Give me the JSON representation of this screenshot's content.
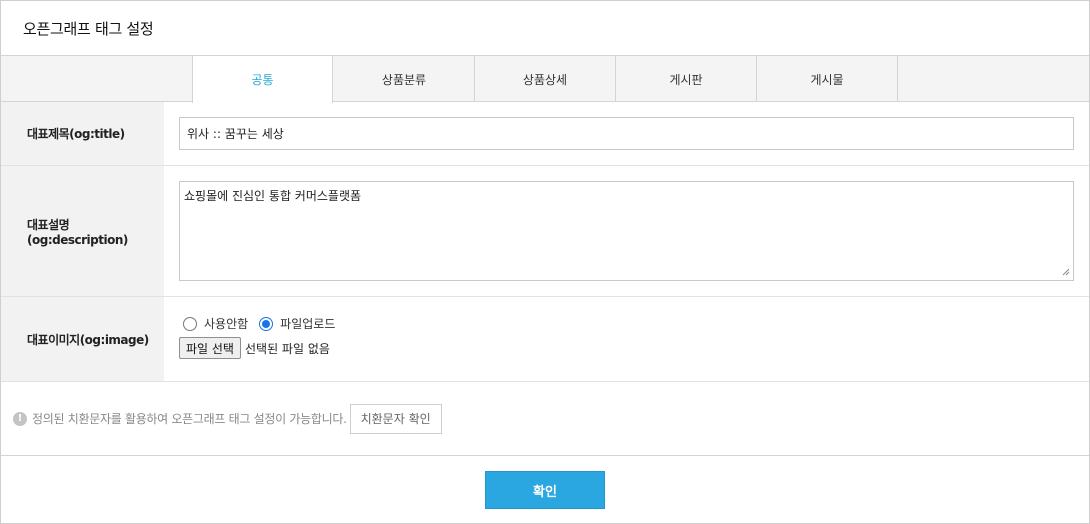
{
  "page": {
    "title": "오픈그래프 태그 설정"
  },
  "tabs": [
    {
      "label": "공통",
      "active": true
    },
    {
      "label": "상품분류",
      "active": false
    },
    {
      "label": "상품상세",
      "active": false
    },
    {
      "label": "게시판",
      "active": false
    },
    {
      "label": "게시물",
      "active": false
    }
  ],
  "form": {
    "og_title": {
      "label": "대표제목(og:title)",
      "value": "위사 :: 꿈꾸는 세상"
    },
    "og_description": {
      "label": "대표설명(og:description)",
      "value": "쇼핑몰에 진심인 통합 커머스플랫폼"
    },
    "og_image": {
      "label": "대표이미지(og:image)",
      "radio_none_label": "사용안함",
      "radio_upload_label": "파일업로드",
      "selected": "upload",
      "file_button_label": "파일 선택",
      "file_status": "선택된 파일 없음"
    }
  },
  "info": {
    "icon": "exclamation-icon",
    "text": "정의된 치환문자를 활용하여 오픈그래프 태그 설정이 가능합니다.",
    "button_label": "치환문자 확인"
  },
  "footer": {
    "confirm_label": "확인"
  },
  "colors": {
    "accent": "#2aa7e0",
    "active_tab_text": "#2aa7d8",
    "radio_checked": "#1a73e8"
  }
}
